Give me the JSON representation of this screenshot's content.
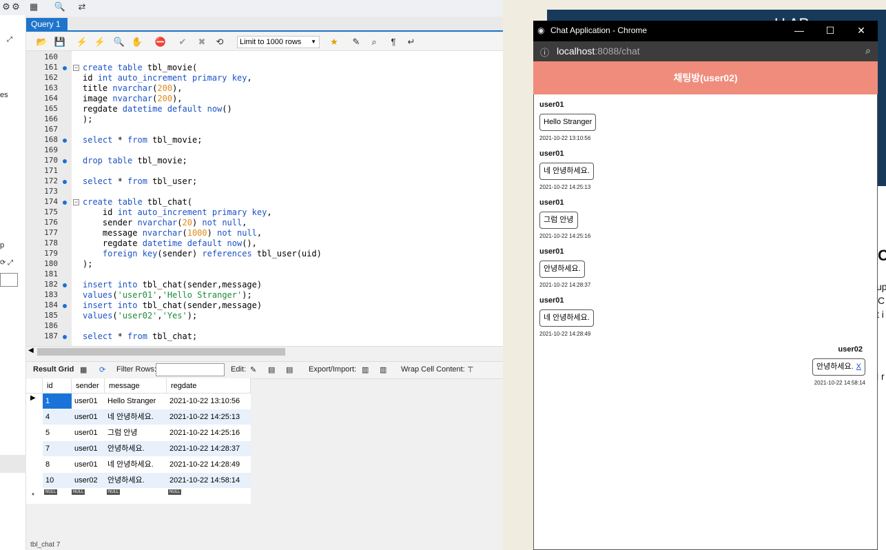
{
  "workbench": {
    "query_tab": "Query 1",
    "limit_select": "Limit to 1000 rows",
    "sidebar_texts": [
      "es",
      "p"
    ],
    "code_lines": [
      {
        "n": "160",
        "dot": false,
        "fold": false,
        "html": ""
      },
      {
        "n": "161",
        "dot": true,
        "fold": true,
        "html": "<span class='kw'>create table</span> tbl_movie("
      },
      {
        "n": "162",
        "dot": false,
        "fold": false,
        "html": "id <span class='kw'>int auto_increment primary key</span>,"
      },
      {
        "n": "163",
        "dot": false,
        "fold": false,
        "html": "title <span class='kw'>nvarchar</span>(<span class='num'>200</span>),"
      },
      {
        "n": "164",
        "dot": false,
        "fold": false,
        "html": "image <span class='kw'>nvarchar</span>(<span class='num'>200</span>),"
      },
      {
        "n": "165",
        "dot": false,
        "fold": false,
        "html": "regdate <span class='kw'>datetime default now</span>()"
      },
      {
        "n": "166",
        "dot": false,
        "fold": false,
        "html": ");"
      },
      {
        "n": "167",
        "dot": false,
        "fold": false,
        "html": ""
      },
      {
        "n": "168",
        "dot": true,
        "fold": false,
        "html": "<span class='kw'>select</span> * <span class='kw'>from</span> tbl_movie;"
      },
      {
        "n": "169",
        "dot": false,
        "fold": false,
        "html": ""
      },
      {
        "n": "170",
        "dot": true,
        "fold": false,
        "html": "<span class='kw'>drop table</span> tbl_movie;"
      },
      {
        "n": "171",
        "dot": false,
        "fold": false,
        "html": ""
      },
      {
        "n": "172",
        "dot": true,
        "fold": false,
        "html": "<span class='kw'>select</span> * <span class='kw'>from</span> tbl_user;"
      },
      {
        "n": "173",
        "dot": false,
        "fold": false,
        "html": ""
      },
      {
        "n": "174",
        "dot": true,
        "fold": true,
        "html": "<span class='kw'>create table</span> tbl_chat("
      },
      {
        "n": "175",
        "dot": false,
        "fold": false,
        "html": "    id <span class='kw'>int auto_increment primary key</span>,"
      },
      {
        "n": "176",
        "dot": false,
        "fold": false,
        "html": "    sender <span class='kw'>nvarchar</span>(<span class='num'>20</span>) <span class='kw'>not null</span>,"
      },
      {
        "n": "177",
        "dot": false,
        "fold": false,
        "html": "    message <span class='kw'>nvarchar</span>(<span class='num'>1000</span>) <span class='kw'>not null</span>,"
      },
      {
        "n": "178",
        "dot": false,
        "fold": false,
        "html": "    regdate <span class='kw'>datetime default now</span>(),"
      },
      {
        "n": "179",
        "dot": false,
        "fold": false,
        "html": "    <span class='kw'>foreign key</span>(sender) <span class='kw'>references</span> tbl_user(uid)"
      },
      {
        "n": "180",
        "dot": false,
        "fold": false,
        "html": ");"
      },
      {
        "n": "181",
        "dot": false,
        "fold": false,
        "html": ""
      },
      {
        "n": "182",
        "dot": true,
        "fold": false,
        "html": "<span class='kw'>insert into</span> tbl_chat(sender,message)"
      },
      {
        "n": "183",
        "dot": false,
        "fold": false,
        "html": "<span class='kw'>values</span>(<span class='str'>'user01'</span>,<span class='str'>'Hello Stranger'</span>);"
      },
      {
        "n": "184",
        "dot": true,
        "fold": false,
        "html": "<span class='kw'>insert into</span> tbl_chat(sender,message)"
      },
      {
        "n": "185",
        "dot": false,
        "fold": false,
        "html": "<span class='kw'>values</span>(<span class='str'>'user02'</span>,<span class='str'>'Yes'</span>);"
      },
      {
        "n": "186",
        "dot": false,
        "fold": false,
        "html": ""
      },
      {
        "n": "187",
        "dot": true,
        "fold": false,
        "html": "<span class='kw'>select</span> * <span class='kw'>from</span> tbl_chat;"
      }
    ],
    "result_bar": {
      "result_grid": "Result Grid",
      "filter_rows": "Filter Rows:",
      "edit": "Edit:",
      "export_import": "Export/Import:",
      "wrap": "Wrap Cell Content:"
    },
    "grid": {
      "columns": [
        "id",
        "sender",
        "message",
        "regdate"
      ],
      "rows": [
        [
          "1",
          "user01",
          "Hello Stranger",
          "2021-10-22 13:10:56"
        ],
        [
          "4",
          "user01",
          "네 안녕하세요.",
          "2021-10-22 14:25:13"
        ],
        [
          "5",
          "user01",
          "그럼 안녕",
          "2021-10-22 14:25:16"
        ],
        [
          "7",
          "user01",
          "안녕하세요.",
          "2021-10-22 14:28:37"
        ],
        [
          "8",
          "user01",
          "네 안녕하세요.",
          "2021-10-22 14:28:49"
        ],
        [
          "10",
          "user02",
          "안녕하세요.",
          "2021-10-22 14:58:14"
        ]
      ],
      "null_label": "NULL"
    },
    "bottom_tab": "tbl_chat 7"
  },
  "chrome": {
    "title": "Chat Application - Chrome",
    "url_host": "localhost",
    "url_rest": ":8088/chat",
    "header": "채팅방(user02)",
    "header_color": "#f08c7c",
    "messages": [
      {
        "sender": "user01",
        "text": "Hello Stranger",
        "time": "2021-10-22 13:10:56",
        "mine": false
      },
      {
        "sender": "user01",
        "text": "네 안녕하세요.",
        "time": "2021-10-22 14:25:13",
        "mine": false
      },
      {
        "sender": "user01",
        "text": "그럼 안녕",
        "time": "2021-10-22 14:25:16",
        "mine": false
      },
      {
        "sender": "user01",
        "text": "안녕하세요.",
        "time": "2021-10-22 14:28:37",
        "mine": false
      },
      {
        "sender": "user01",
        "text": "네 안녕하세요.",
        "time": "2021-10-22 14:28:49",
        "mine": false
      },
      {
        "sender": "user02",
        "text": "안녕하세요.",
        "time": "2021-10-22 14:58:14",
        "mine": true,
        "delete": "X"
      }
    ]
  },
  "background_text": {
    "top": "U    AP",
    "c": "C",
    "up": "up",
    "c2": "C",
    "ti": "t i",
    "lr": "l r"
  }
}
